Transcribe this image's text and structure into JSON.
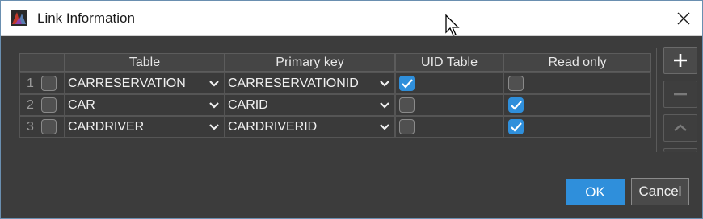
{
  "window": {
    "title": "Link Information"
  },
  "table": {
    "headers": [
      "",
      "Table",
      "Primary key",
      "UID Table",
      "Read only"
    ],
    "rows": [
      {
        "num": "1",
        "selected": false,
        "table": "CARRESERVATION",
        "primary_key": "CARRESERVATIONID",
        "uid_table": true,
        "read_only": false
      },
      {
        "num": "2",
        "selected": false,
        "table": "CAR",
        "primary_key": "CARID",
        "uid_table": false,
        "read_only": true
      },
      {
        "num": "3",
        "selected": false,
        "table": "CARDRIVER",
        "primary_key": "CARDRIVERID",
        "uid_table": false,
        "read_only": true
      }
    ]
  },
  "side_buttons": [
    "add-icon",
    "remove-icon",
    "move-up-icon"
  ],
  "buttons": {
    "ok_label": "OK",
    "cancel_label": "Cancel"
  },
  "colors": {
    "accent": "#2f8fdb",
    "background": "#3c3c3c"
  }
}
